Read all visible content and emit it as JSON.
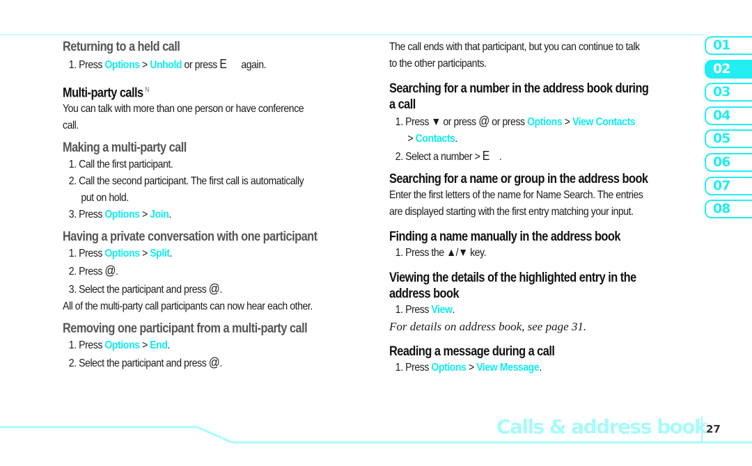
{
  "left": {
    "returning": {
      "heading": "Returning to a held call",
      "step1": {
        "num": "1.",
        "pre": "Press ",
        "opt": "Options",
        "gt": " > ",
        "act": "Unhold",
        "post": " or press ",
        "key": "E",
        "post2": "      again."
      }
    },
    "multiparty": {
      "heading": "Multi-party calls",
      "sup": "N",
      "body_line1": "You can talk with more than one person or have conference",
      "body_line2": "call."
    },
    "making": {
      "heading": "Making a multi-party call",
      "step1": "1. Call the first participant.",
      "step2_line1": "2. Call the second participant. The first call is automatically",
      "step2_line2": "put on hold.",
      "step3": {
        "num": "3. Press ",
        "opt": "Options",
        "gt": " > ",
        "act": "Join",
        "end": "."
      }
    },
    "private": {
      "heading": "Having a private conversation with one participant",
      "step1": {
        "num": "1. Press ",
        "opt": "Options",
        "gt": " > ",
        "act": "Split",
        "end": "."
      },
      "step2": {
        "text": "2. Press ",
        "key": "@",
        "end": "."
      },
      "step3": {
        "text": "3. Select the participant and press ",
        "key": "@",
        "end": "."
      },
      "note": "All of the multi-party call participants can now hear each other."
    },
    "removing": {
      "heading": "Removing one participant from a multi-party call",
      "step1": {
        "num": "1. Press ",
        "opt": "Options",
        "gt": " > ",
        "act": "End",
        "end": "."
      },
      "step2": {
        "text": "2. Select the participant and press ",
        "key": "@",
        "end": "."
      }
    }
  },
  "right": {
    "intro_line1": "The call ends with that participant, but you can continue to talk",
    "intro_line2": "to the other participants.",
    "searching_number": {
      "heading_line1": "Searching for a number in the address book during",
      "heading_line2": "a call",
      "step1": {
        "num": "1. Press ",
        "down": "▼",
        "mid": " or press ",
        "key": "@",
        "mid2": " or press ",
        "opt": "Options",
        "gt": " > ",
        "act": "View Contacts"
      },
      "step1_cont": {
        "gt": "> ",
        "act": "Contacts",
        "end": "."
      },
      "step2": {
        "text": "2. Select a number > ",
        "key": "E",
        "end": "    ."
      }
    },
    "searching_name": {
      "heading": "Searching for a name or group in the address book",
      "body_line1": "Enter the first letters of the name for Name Search. The entries",
      "body_line2": "are displayed starting with the first entry matching your input."
    },
    "finding": {
      "heading": "Finding a name manually in the address book",
      "step1": {
        "text": "1. Press the ",
        "keys": "▲/▼",
        "end": " key."
      }
    },
    "viewing": {
      "heading_line1": "Viewing the details of the highlighted entry in the",
      "heading_line2": "address book",
      "step1": {
        "num": "1. Press ",
        "act": "View",
        "end": "."
      },
      "note": "For details on address book, see page 31."
    },
    "reading": {
      "heading": "Reading a message during a call",
      "step1": {
        "num": "1. Press ",
        "opt": "Options",
        "gt": " > ",
        "act": "View Message",
        "end": "."
      }
    }
  },
  "chapter_tabs": [
    {
      "label": "01",
      "active": false
    },
    {
      "label": "02",
      "active": true
    },
    {
      "label": "03",
      "active": false
    },
    {
      "label": "04",
      "active": false
    },
    {
      "label": "05",
      "active": false
    },
    {
      "label": "06",
      "active": false
    },
    {
      "label": "07",
      "active": false
    },
    {
      "label": "08",
      "active": false
    }
  ],
  "footer": {
    "section_title": "Calls & address book",
    "page_number": "27"
  },
  "colors": {
    "highlight": "#12ecf0",
    "tab_accent": "#22eef2",
    "footer_accent": "#a8fafa"
  }
}
